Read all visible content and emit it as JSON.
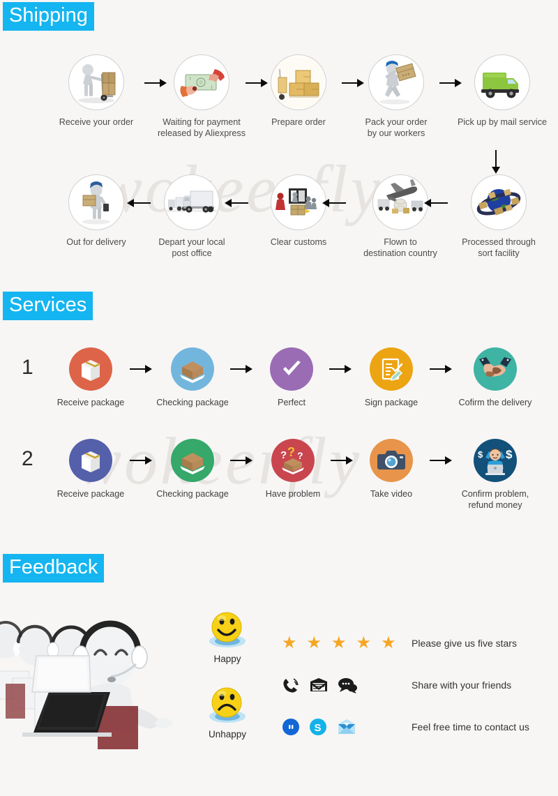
{
  "page": {
    "background_color": "#f7f6f5",
    "accent_color": "#14b5f0",
    "watermark_text": "wokeerfly"
  },
  "sections": {
    "shipping": {
      "title": "Shipping"
    },
    "services": {
      "title": "Services"
    },
    "feedback": {
      "title": "Feedback"
    }
  },
  "shipping": {
    "row1": [
      {
        "label": "Receive your order",
        "icon": "hand-truck-box-icon"
      },
      {
        "label": "Waiting for payment\nreleased by Aliexpress",
        "icon": "cash-handover-icon"
      },
      {
        "label": "Prepare  order",
        "icon": "cardboard-boxes-icon"
      },
      {
        "label": "Pack your order\nby our workers",
        "icon": "worker-carrying-box-icon"
      },
      {
        "label": "Pick up by mail service",
        "icon": "green-delivery-truck-icon"
      }
    ],
    "row2": [
      {
        "label": "Out for delivery",
        "icon": "postman-parcel-icon"
      },
      {
        "label": "Depart your local\npost office",
        "icon": "truck-fleet-icon"
      },
      {
        "label": "Clear customs",
        "icon": "customs-inspection-icon"
      },
      {
        "label": "Flown to\ndestination country",
        "icon": "airplane-cargo-icon"
      },
      {
        "label": "Processed through\nsort facility",
        "icon": "globe-parcels-icon"
      }
    ]
  },
  "services": {
    "rows": [
      {
        "number": "1",
        "steps": [
          {
            "label": "Receive package",
            "icon": "closed-package-icon",
            "color": "#dd6448"
          },
          {
            "label": "Checking package",
            "icon": "open-box-icon",
            "color": "#73b6dd"
          },
          {
            "label": "Perfect",
            "icon": "check-mark-icon",
            "color": "#9a6cb4"
          },
          {
            "label": "Sign package",
            "icon": "sign-document-icon",
            "color": "#eca412"
          },
          {
            "label": "Cofirm the delivery",
            "icon": "handshake-icon",
            "color": "#3fb3a4"
          }
        ]
      },
      {
        "number": "2",
        "steps": [
          {
            "label": "Receive package",
            "icon": "closed-package-icon",
            "color": "#5560ab"
          },
          {
            "label": "Checking package",
            "icon": "open-box-icon",
            "color": "#35a86a"
          },
          {
            "label": "Have  problem",
            "icon": "question-box-icon",
            "color": "#c9464f"
          },
          {
            "label": "Take video",
            "icon": "camera-icon",
            "color": "#e8944a"
          },
          {
            "label": "Confirm problem,\nrefund money",
            "icon": "support-agent-money-icon",
            "color": "#13507a"
          }
        ]
      }
    ]
  },
  "feedback": {
    "support_image_alt": "call-center-agents-icon",
    "emojis": [
      {
        "label": "Happy",
        "icon": "happy-face-icon"
      },
      {
        "label": "Unhappy",
        "icon": "unhappy-face-icon"
      }
    ],
    "rows": [
      {
        "icons": [
          "star-icon",
          "star-icon",
          "star-icon",
          "star-icon",
          "star-icon"
        ],
        "text": "Please give us five stars",
        "star_count": 5,
        "star_color": "#f5a623"
      },
      {
        "icons": [
          "phone-ring-icon",
          "envelope-icon",
          "chat-bubbles-icon"
        ],
        "text": "Share with your friends"
      },
      {
        "icons": [
          "aliwangwang-icon",
          "skype-icon",
          "mail-open-icon"
        ],
        "text": "Feel free time to contact us"
      }
    ]
  }
}
